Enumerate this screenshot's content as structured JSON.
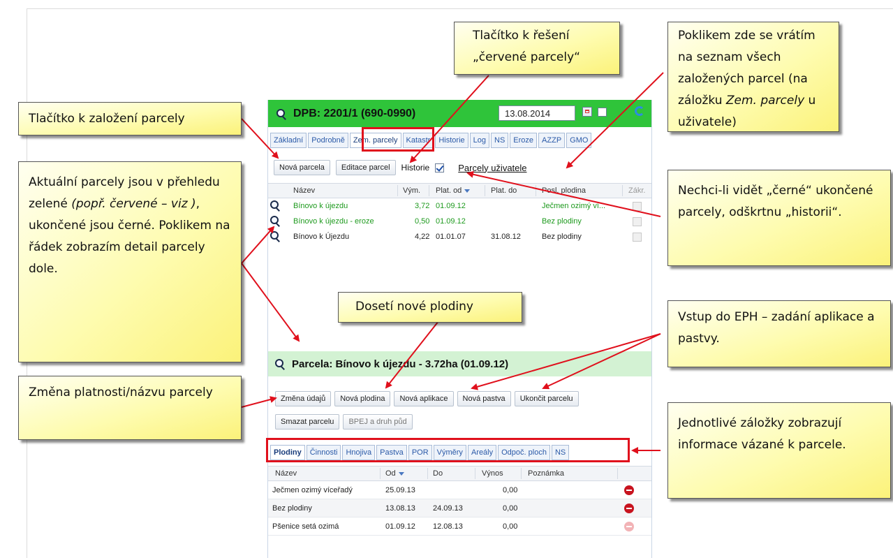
{
  "header": {
    "title": "DPB: 2201/1 (690-0990)",
    "date": "13.08.2014"
  },
  "tabs": [
    "Základní",
    "Podrobně",
    "Zem. parcely",
    "Katastr",
    "Historie",
    "Log",
    "NS",
    "Eroze",
    "AZZP",
    "GMO"
  ],
  "toolbar": {
    "new_parcel": "Nová parcela",
    "edit_parcels": "Editace parcel",
    "history_label": "Historie",
    "user_parcels_link": "Parcely uživatele"
  },
  "parcel_grid": {
    "columns": [
      "Název",
      "Vým.",
      "Plat. od",
      "Plat. do",
      "Posl. plodina",
      "Zákr."
    ],
    "rows": [
      {
        "name": "Bínovo k újezdu",
        "area": "3,72",
        "from": "01.09.12",
        "to": "",
        "crop": "Ječmen ozimý ví...",
        "status": "active"
      },
      {
        "name": "Bínovo k újezdu - eroze",
        "area": "0,50",
        "from": "01.09.12",
        "to": "",
        "crop": "Bez plodiny",
        "status": "active"
      },
      {
        "name": "Bínovo k Újezdu",
        "area": "4,22",
        "from": "01.01.07",
        "to": "31.08.12",
        "crop": "Bez plodiny",
        "status": "ended"
      }
    ]
  },
  "parcel_detail": {
    "title": "Parcela: Bínovo k újezdu - 3.72ha (01.09.12)",
    "buttons": [
      "Změna údajů",
      "Nová plodina",
      "Nová aplikace",
      "Nová pastva",
      "Ukončit parcelu"
    ],
    "buttons2": [
      "Smazat parcelu",
      "BPEJ a druh půd"
    ],
    "tabs": [
      "Plodiny",
      "Činnosti",
      "Hnojiva",
      "Pastva",
      "POR",
      "Výměry",
      "Areály",
      "Odpoč. ploch",
      "NS"
    ]
  },
  "crop_grid": {
    "columns": [
      "Název",
      "Od",
      "Do",
      "Výnos",
      "Poznámka"
    ],
    "rows": [
      {
        "name": "Ječmen ozimý víceřadý",
        "from": "25.09.13",
        "to": "",
        "yield": "0,00",
        "note": ""
      },
      {
        "name": "Bez plodiny",
        "from": "13.08.13",
        "to": "24.09.13",
        "yield": "0,00",
        "note": ""
      },
      {
        "name": "Pšenice setá ozimá",
        "from": "01.09.12",
        "to": "12.08.13",
        "yield": "0,00",
        "note": ""
      }
    ]
  },
  "callouts": {
    "new_parcel": "Tlačítko k založení parcely",
    "red_parcels_line1": "Tlačítko k řešení",
    "red_parcels_line2": "„červené parcely“",
    "back_to_list_a": "Poklikem zde se vrátím na seznam všech založených parcel (na záložku ",
    "back_to_list_b": "Zem. parcely",
    "back_to_list_c": " u uživatele)",
    "current_parcels_a": "Aktuální parcely jsou v přehledu zelené ",
    "current_parcels_b": "(popř. červené – viz )",
    "current_parcels_c": ", ukončené jsou černé. Poklikem na řádek zobrazím detail parcely dole.",
    "hide_history": "Nechci-li vidět „černé“ ukončené parcely, odškrtnu „historii“.",
    "new_crop": "Dosetí nové plodiny",
    "eph_entry": "Vstup do EPH – zadání aplikace a pastvy.",
    "change_validity": "Změna platnosti/názvu parcely",
    "tabs_info": "Jednotlivé záložky zobrazují informace vázané k parcele."
  },
  "colors": {
    "header_green": "#2fc43a",
    "active_parcel_text": "#1e9a1e",
    "highlight_red": "#e0101c",
    "callout_yellow": "#fefcb0"
  }
}
